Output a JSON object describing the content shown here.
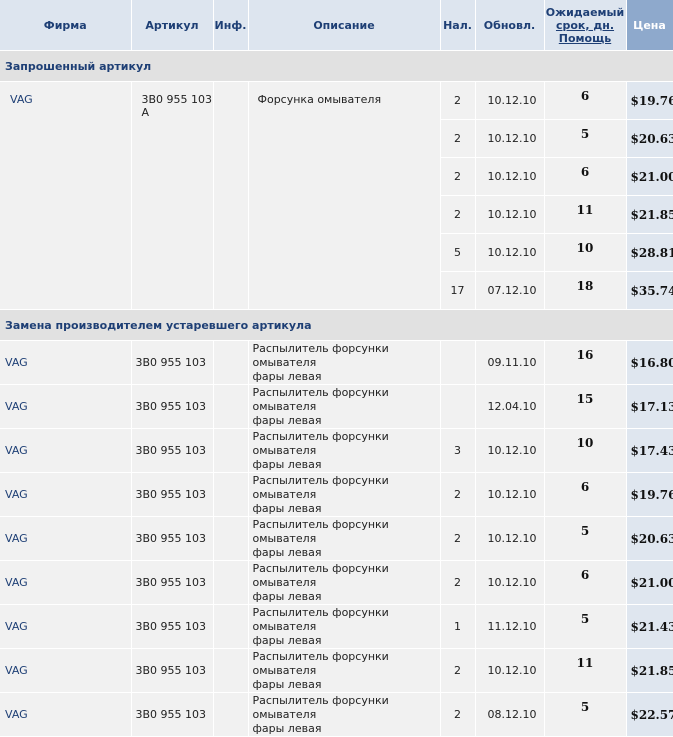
{
  "headers": {
    "firm": "Фирма",
    "article": "Артикул",
    "info": "Инф.",
    "description": "Описание",
    "qty": "Нал.",
    "updated": "Обновл.",
    "term_line1": "Ожидаемый",
    "term_line2": "срок, дн.",
    "term_help": "Помощь",
    "price": "Цена"
  },
  "sections": {
    "requested": "Запрошенный артикул",
    "replacement": "Замена производителем устаревшего артикула"
  },
  "requested": {
    "firm": "VAG",
    "article": "3B0 955 103 A",
    "description": "Форсунка омывателя",
    "offers": [
      {
        "qty": "2",
        "date": "10.12.10",
        "term": "6",
        "price": "$19.76"
      },
      {
        "qty": "2",
        "date": "10.12.10",
        "term": "5",
        "price": "$20.63"
      },
      {
        "qty": "2",
        "date": "10.12.10",
        "term": "6",
        "price": "$21.00"
      },
      {
        "qty": "2",
        "date": "10.12.10",
        "term": "11",
        "price": "$21.85"
      },
      {
        "qty": "5",
        "date": "10.12.10",
        "term": "10",
        "price": "$28.81"
      },
      {
        "qty": "17",
        "date": "07.12.10",
        "term": "18",
        "price": "$35.74"
      }
    ]
  },
  "replacement_rows": [
    {
      "firm": "VAG",
      "article": "3B0 955 103",
      "desc1": "Распылитель форсунки омывателя",
      "desc2": "фары левая",
      "qty": "",
      "date": "09.11.10",
      "term": "16",
      "price": "$16.80"
    },
    {
      "firm": "VAG",
      "article": "3B0 955 103",
      "desc1": "Распылитель форсунки омывателя",
      "desc2": "фары левая",
      "qty": "",
      "date": "12.04.10",
      "term": "15",
      "price": "$17.13"
    },
    {
      "firm": "VAG",
      "article": "3B0 955 103",
      "desc1": "Распылитель форсунки омывателя",
      "desc2": "фары левая",
      "qty": "3",
      "date": "10.12.10",
      "term": "10",
      "price": "$17.43"
    },
    {
      "firm": "VAG",
      "article": "3B0 955 103",
      "desc1": "Распылитель форсунки омывателя",
      "desc2": "фары левая",
      "qty": "2",
      "date": "10.12.10",
      "term": "6",
      "price": "$19.76"
    },
    {
      "firm": "VAG",
      "article": "3B0 955 103",
      "desc1": "Распылитель форсунки омывателя",
      "desc2": "фары левая",
      "qty": "2",
      "date": "10.12.10",
      "term": "5",
      "price": "$20.63"
    },
    {
      "firm": "VAG",
      "article": "3B0 955 103",
      "desc1": "Распылитель форсунки омывателя",
      "desc2": "фары левая",
      "qty": "2",
      "date": "10.12.10",
      "term": "6",
      "price": "$21.00"
    },
    {
      "firm": "VAG",
      "article": "3B0 955 103",
      "desc1": "Распылитель форсунки омывателя",
      "desc2": "фары левая",
      "qty": "1",
      "date": "11.12.10",
      "term": "5",
      "price": "$21.43"
    },
    {
      "firm": "VAG",
      "article": "3B0 955 103",
      "desc1": "Распылитель форсунки омывателя",
      "desc2": "фары левая",
      "qty": "2",
      "date": "10.12.10",
      "term": "11",
      "price": "$21.85"
    },
    {
      "firm": "VAG",
      "article": "3B0 955 103",
      "desc1": "Распылитель форсунки омывателя",
      "desc2": "фары левая",
      "qty": "2",
      "date": "08.12.10",
      "term": "5",
      "price": "$22.57"
    }
  ]
}
